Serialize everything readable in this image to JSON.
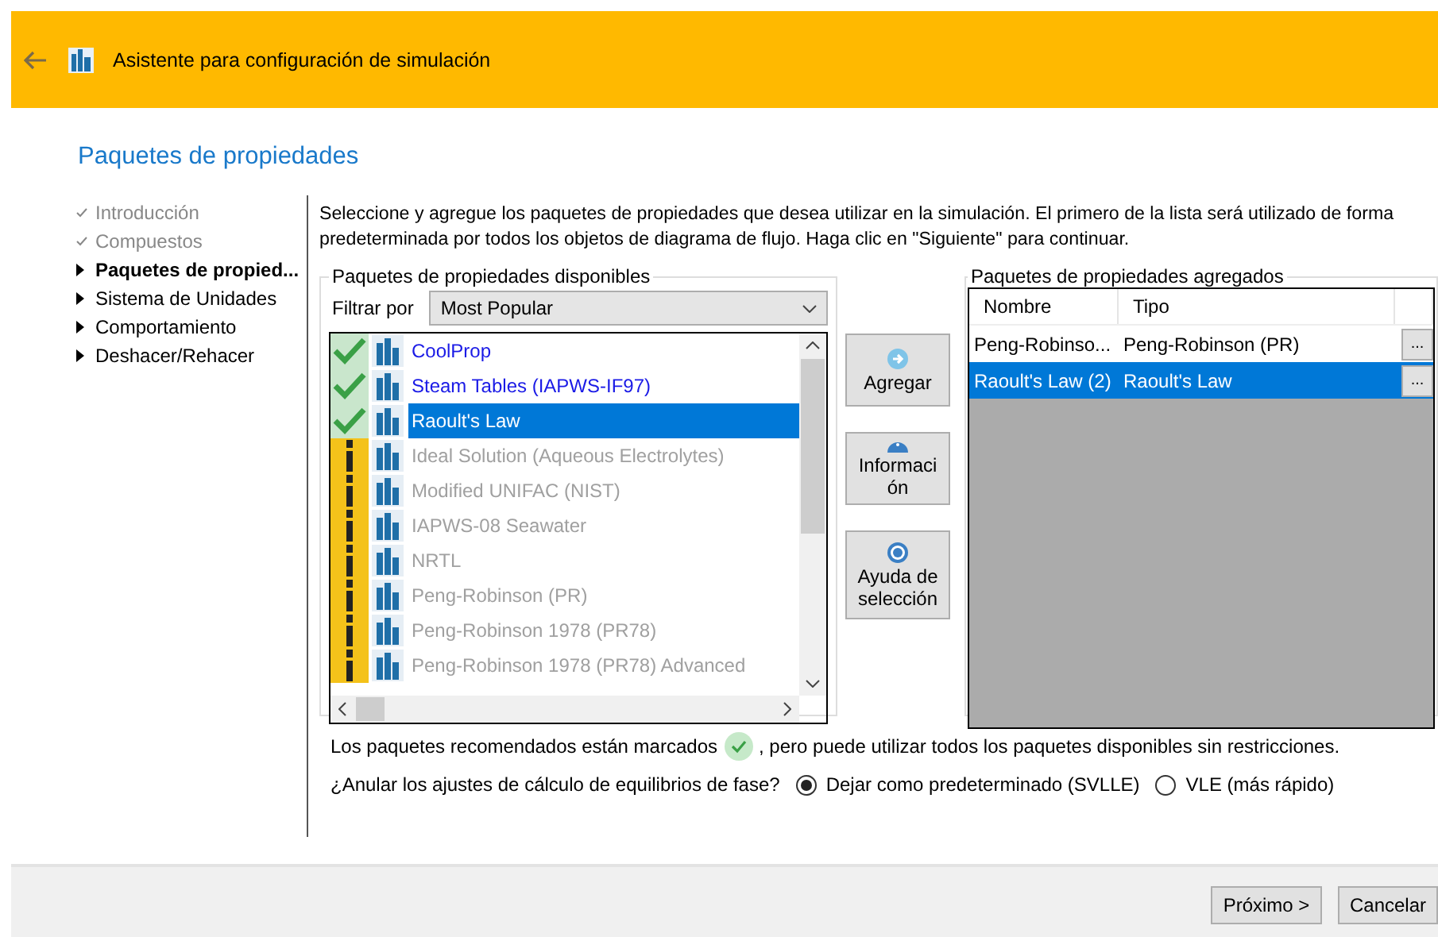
{
  "window": {
    "title": "Asistente para configuración de simulación"
  },
  "page_title": "Paquetes de propiedades",
  "steps": [
    {
      "label": "Introducción",
      "done": true,
      "selected": false
    },
    {
      "label": "Compuestos",
      "done": true,
      "selected": false
    },
    {
      "label": "Paquetes de propied...",
      "done": false,
      "selected": true
    },
    {
      "label": "Sistema de Unidades",
      "done": false,
      "selected": false
    },
    {
      "label": "Comportamiento",
      "done": false,
      "selected": false
    },
    {
      "label": "Deshacer/Rehacer",
      "done": false,
      "selected": false
    }
  ],
  "intro": "Seleccione y agregue los paquetes de propiedades que desea utilizar en la simulación. El primero de la lista será utilizado de forma predeterminada por todos los objetos de diagrama de flujo. Haga clic en \"Siguiente\" para continuar.",
  "available": {
    "legend": "Paquetes de propiedades disponibles",
    "filter_label": "Filtrar por",
    "filter_value": "Most Popular",
    "items": [
      {
        "name": "CoolProp",
        "kind": "recommended",
        "selected": false
      },
      {
        "name": "Steam Tables (IAPWS-IF97)",
        "kind": "recommended",
        "selected": false
      },
      {
        "name": "Raoult's Law",
        "kind": "recommended",
        "selected": true
      },
      {
        "name": "Ideal Solution (Aqueous Electrolytes)",
        "kind": "other",
        "selected": false
      },
      {
        "name": "Modified UNIFAC (NIST)",
        "kind": "other",
        "selected": false
      },
      {
        "name": "IAPWS-08 Seawater",
        "kind": "other",
        "selected": false
      },
      {
        "name": "NRTL",
        "kind": "other",
        "selected": false
      },
      {
        "name": "Peng-Robinson (PR)",
        "kind": "other",
        "selected": false
      },
      {
        "name": "Peng-Robinson 1978 (PR78)",
        "kind": "other",
        "selected": false
      },
      {
        "name": "Peng-Robinson 1978 (PR78) Advanced",
        "kind": "other",
        "selected": false
      }
    ]
  },
  "actions": [
    {
      "label": "Agregar",
      "kind": "add"
    },
    {
      "label": "Informaci ón",
      "kind": "info"
    },
    {
      "label": "Ayuda de selección",
      "kind": "help"
    }
  ],
  "added": {
    "legend": "Paquetes de propiedades agregados",
    "columns": [
      "Nombre",
      "Tipo"
    ],
    "rows": [
      {
        "name": "Peng-Robinso...",
        "type": "Peng-Robinson (PR)",
        "button": "...",
        "selected": false
      },
      {
        "name": "Raoult's Law (2)",
        "type": "Raoult's Law",
        "button": "...",
        "selected": true
      }
    ]
  },
  "note_before": "Los paquetes recomendados están marcados",
  "note_after": ", pero puede utilizar todos los paquetes disponibles sin restricciones.",
  "phase": {
    "question": "¿Anular los ajustes de cálculo de equilibrios de fase?",
    "options": [
      {
        "label": "Dejar como predeterminado (SVLLE)",
        "selected": true
      },
      {
        "label": "VLE (más rápido)",
        "selected": false
      }
    ]
  },
  "footer": {
    "buttons": [
      "Próximo >",
      "Cancelar"
    ]
  }
}
